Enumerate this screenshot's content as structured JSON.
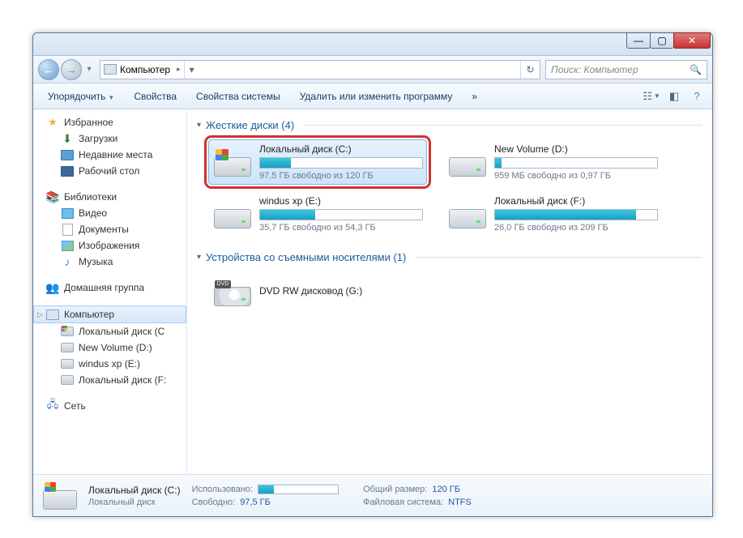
{
  "breadcrumb": {
    "root": "Компьютер"
  },
  "search": {
    "placeholder": "Поиск: Компьютер"
  },
  "toolbar": {
    "organize": "Упорядочить",
    "properties": "Свойства",
    "sysprops": "Свойства системы",
    "uninstall": "Удалить или изменить программу"
  },
  "sidebar": {
    "favorites": {
      "label": "Избранное",
      "items": [
        "Загрузки",
        "Недавние места",
        "Рабочий стол"
      ]
    },
    "libraries": {
      "label": "Библиотеки",
      "items": [
        "Видео",
        "Документы",
        "Изображения",
        "Музыка"
      ]
    },
    "homegroup": {
      "label": "Домашняя группа"
    },
    "computer": {
      "label": "Компьютер",
      "items": [
        "Локальный диск (C",
        "New Volume (D:)",
        "windus xp (E:)",
        "Локальный диск (F:"
      ]
    },
    "network": {
      "label": "Сеть"
    }
  },
  "categories": {
    "hdd": "Жесткие диски (4)",
    "removable": "Устройства со съемными носителями (1)"
  },
  "drives": {
    "c": {
      "name": "Локальный диск (C:)",
      "free": "97,5 ГБ свободно из 120 ГБ",
      "fill_pct": 19
    },
    "d": {
      "name": "New Volume (D:)",
      "free": "959 МБ свободно из 0,97 ГБ",
      "fill_pct": 4
    },
    "e": {
      "name": "windus xp (E:)",
      "free": "35,7 ГБ свободно из 54,3 ГБ",
      "fill_pct": 34
    },
    "f": {
      "name": "Локальный диск (F:)",
      "free": "26,0 ГБ свободно из 209 ГБ",
      "fill_pct": 87
    },
    "g": {
      "name": "DVD RW дисковод (G:)"
    }
  },
  "details": {
    "name": "Локальный диск (C:)",
    "type": "Локальный диск",
    "used_label": "Использовано:",
    "free_label": "Свободно:",
    "free_val": "97,5 ГБ",
    "size_label": "Общий размер:",
    "size_val": "120 ГБ",
    "fs_label": "Файловая система:",
    "fs_val": "NTFS",
    "used_pct": 19
  }
}
